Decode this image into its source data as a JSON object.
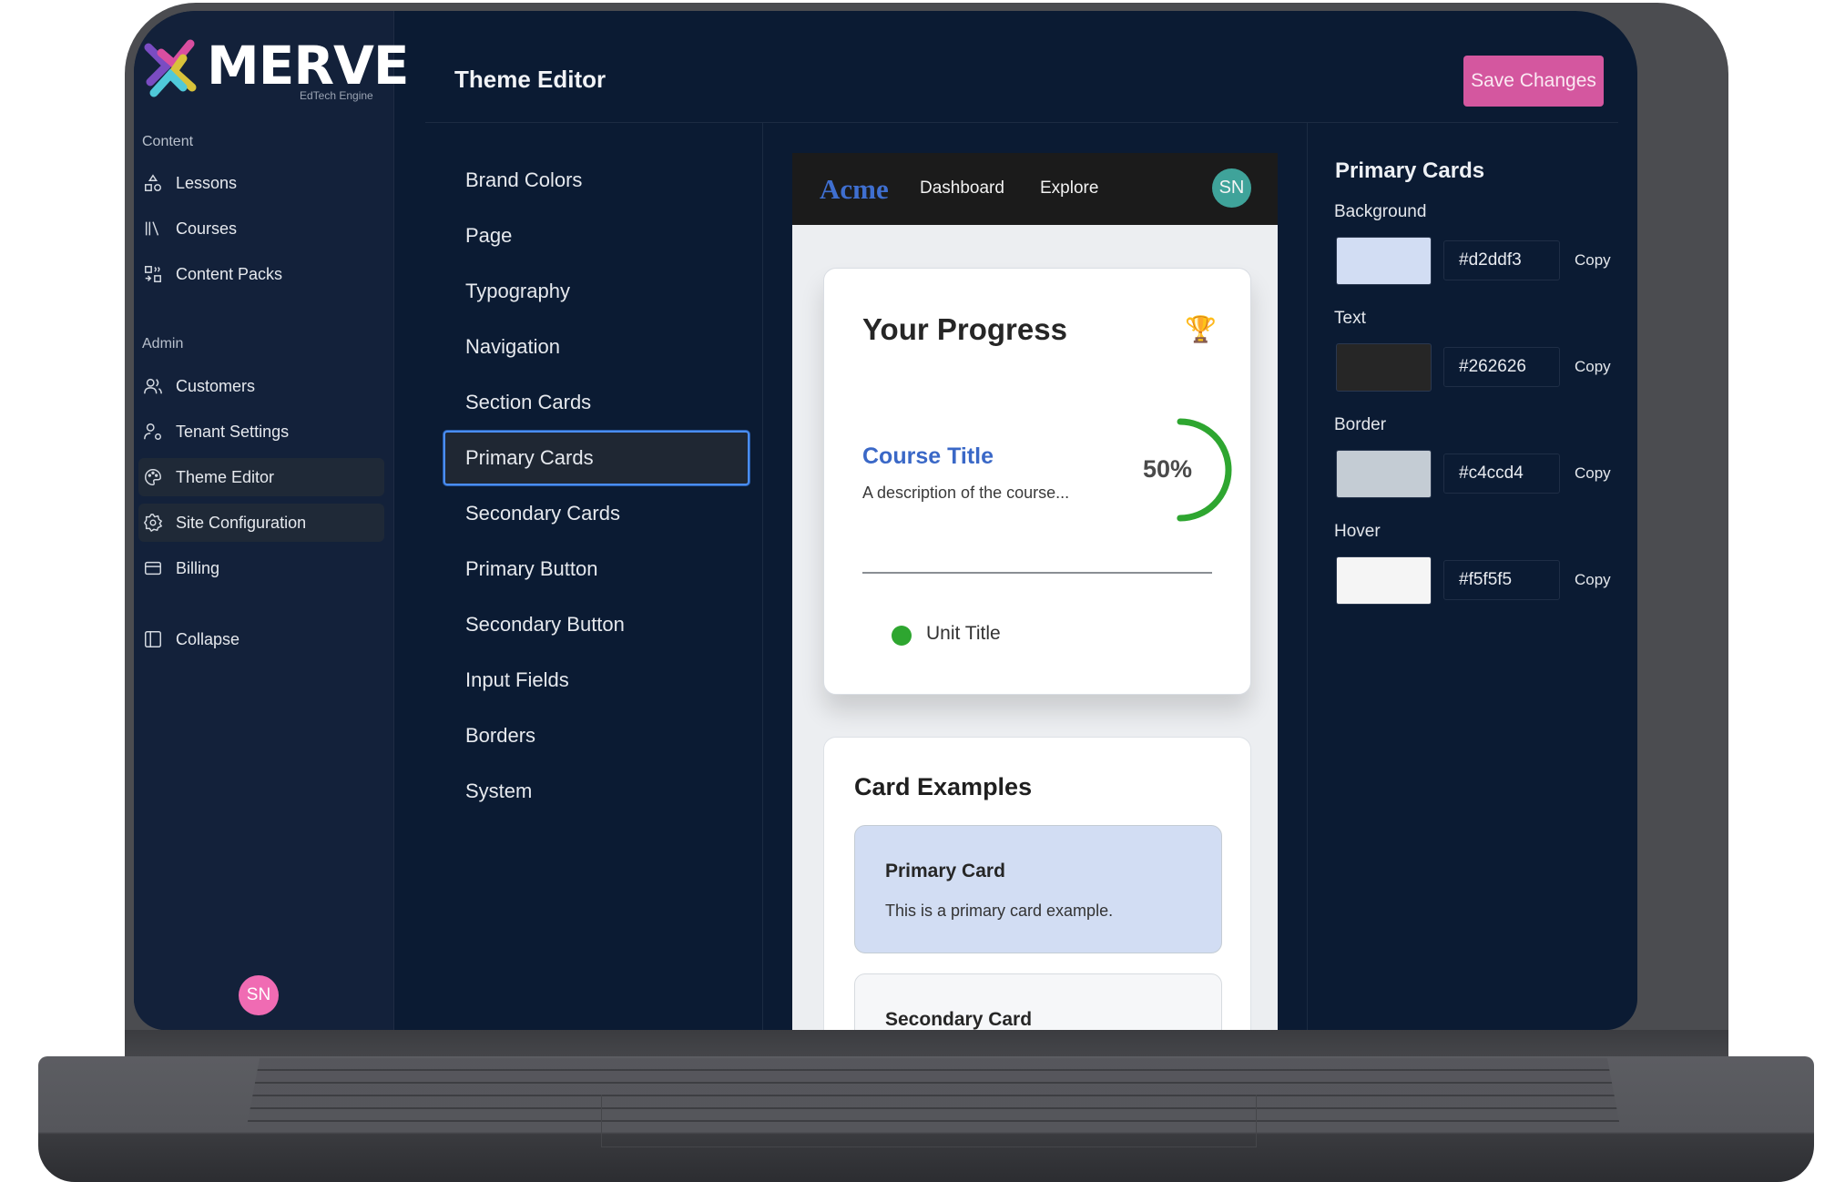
{
  "brand": {
    "name": "MERVE",
    "tagline": "EdTech Engine"
  },
  "sidebar": {
    "sections": [
      {
        "label": "Content",
        "items": [
          {
            "label": "Lessons",
            "icon": "shapes-icon"
          },
          {
            "label": "Courses",
            "icon": "library-icon"
          },
          {
            "label": "Content Packs",
            "icon": "packs-icon"
          }
        ]
      },
      {
        "label": "Admin",
        "items": [
          {
            "label": "Customers",
            "icon": "users-icon"
          },
          {
            "label": "Tenant Settings",
            "icon": "user-cog-icon"
          },
          {
            "label": "Theme Editor",
            "icon": "palette-icon",
            "active": true
          },
          {
            "label": "Site Configuration",
            "icon": "gear-icon",
            "active": true
          },
          {
            "label": "Billing",
            "icon": "credit-card-icon"
          }
        ]
      }
    ],
    "collapse_label": "Collapse",
    "user_initials": "SN"
  },
  "header": {
    "title": "Theme Editor",
    "save_label": "Save Changes"
  },
  "theme_sections": {
    "items": [
      "Brand Colors",
      "Page",
      "Typography",
      "Navigation",
      "Section Cards",
      "Primary Cards",
      "Secondary Cards",
      "Primary Button",
      "Secondary Button",
      "Input Fields",
      "Borders",
      "System"
    ],
    "selected": "Primary Cards"
  },
  "preview": {
    "nav": {
      "brand": "Acme",
      "links": [
        "Dashboard",
        "Explore"
      ],
      "user_initials": "SN"
    },
    "progress_card": {
      "title": "Your Progress",
      "course_title": "Course Title",
      "course_description": "A description of the course...",
      "progress_percent": 50,
      "progress_label": "50%",
      "unit_title": "Unit Title"
    },
    "card_examples": {
      "title": "Card Examples",
      "primary": {
        "title": "Primary Card",
        "body": "This is a primary card example."
      },
      "secondary": {
        "title": "Secondary Card"
      }
    }
  },
  "settings_panel": {
    "title": "Primary Cards",
    "copy_label": "Copy",
    "fields": [
      {
        "label": "Background",
        "value": "#d2ddf3"
      },
      {
        "label": "Text",
        "value": "#262626"
      },
      {
        "label": "Border",
        "value": "#c4ccd4"
      },
      {
        "label": "Hover",
        "value": "#f5f5f5"
      }
    ]
  },
  "colors": {
    "accent": "#d4579f",
    "sidebar_bg": "#13213a",
    "main_bg": "#0b1b33",
    "selection_border": "#4a8df2",
    "progress_green": "#2ea630",
    "link_blue": "#3a68c7"
  }
}
